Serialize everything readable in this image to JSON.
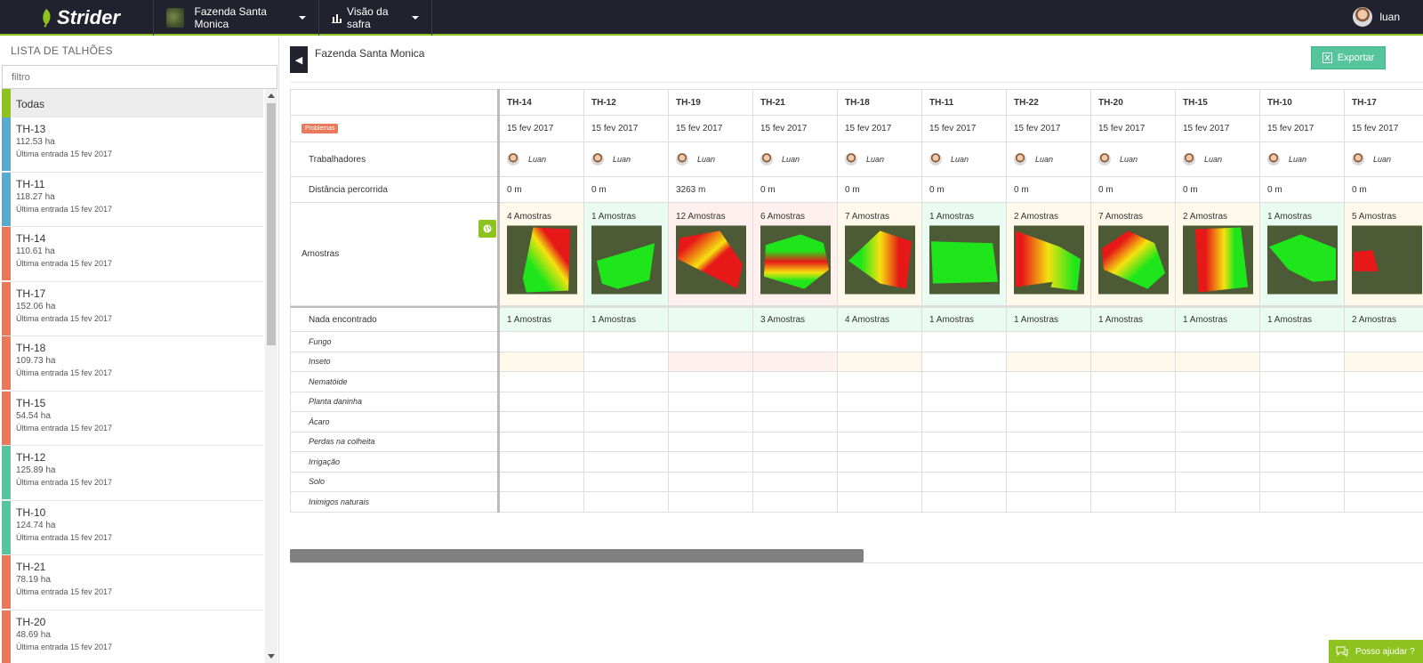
{
  "app": {
    "brand": "Strider",
    "farm": "Fazenda Santa Monica",
    "view": "Visão da safra",
    "user": "luan"
  },
  "sidebar": {
    "title": "LISTA DE TALHÕES",
    "filter_placeholder": "filtro",
    "all_label": "Todas",
    "items": [
      {
        "name": "TH-13",
        "area": "112.53 ha",
        "date": "Última entrada 15 fev 2017",
        "color": "#5aa9cf"
      },
      {
        "name": "TH-11",
        "area": "118.27 ha",
        "date": "Última entrada 15 fev 2017",
        "color": "#5aa9cf"
      },
      {
        "name": "TH-14",
        "area": "110.61 ha",
        "date": "Última entrada 15 fev 2017",
        "color": "#e8795a"
      },
      {
        "name": "TH-17",
        "area": "152.06 ha",
        "date": "Última entrada 15 fev 2017",
        "color": "#e8795a"
      },
      {
        "name": "TH-18",
        "area": "109.73 ha",
        "date": "Última entrada 15 fev 2017",
        "color": "#e8795a"
      },
      {
        "name": "TH-15",
        "area": "54.54 ha",
        "date": "Última entrada 15 fev 2017",
        "color": "#e8795a"
      },
      {
        "name": "TH-12",
        "area": "125.89 ha",
        "date": "Última entrada 15 fev 2017",
        "color": "#56c59e"
      },
      {
        "name": "TH-10",
        "area": "124.74 ha",
        "date": "Última entrada 15 fev 2017",
        "color": "#56c59e"
      },
      {
        "name": "TH-21",
        "area": "78.19 ha",
        "date": "Última entrada 15 fev 2017",
        "color": "#e8795a"
      },
      {
        "name": "TH-20",
        "area": "48.69 ha",
        "date": "Última entrada 15 fev 2017",
        "color": "#e8795a"
      }
    ]
  },
  "main": {
    "title": "Fazenda Santa Monica",
    "export_label": "Exportar",
    "row_labels": {
      "problems": "Problemas",
      "workers": "Trabalhadores",
      "distance": "Distância percorrida",
      "samples": "Amostras",
      "nothing": "Nada encontrado",
      "subs": [
        "Fungo",
        "Inseto",
        "Nematóide",
        "Planta daninha",
        "Ácaro",
        "Perdas na colheita",
        "Irrigação",
        "Solo",
        "Inimigos naturais"
      ]
    },
    "columns": [
      {
        "name": "TH-14",
        "date": "15 fev 2017",
        "worker": "Luan",
        "distance": "0 m",
        "samples": "4 Amostras",
        "nothing": "1 Amostras",
        "sample_bg": "#fff9ec",
        "inseto_bg": "#fff9ec",
        "map": "a"
      },
      {
        "name": "TH-12",
        "date": "15 fev 2017",
        "worker": "Luan",
        "distance": "0 m",
        "samples": "1 Amostras",
        "nothing": "1 Amostras",
        "sample_bg": "#eafbf1",
        "inseto_bg": "#ffffff",
        "map": "b"
      },
      {
        "name": "TH-19",
        "date": "15 fev 2017",
        "worker": "Luan",
        "distance": "3263 m",
        "samples": "12 Amostras",
        "nothing": "",
        "sample_bg": "#fdf0ee",
        "inseto_bg": "#fdf0ee",
        "map": "c"
      },
      {
        "name": "TH-21",
        "date": "15 fev 2017",
        "worker": "Luan",
        "distance": "0 m",
        "samples": "6 Amostras",
        "nothing": "3 Amostras",
        "sample_bg": "#fdf0ee",
        "inseto_bg": "#fdf0ee",
        "map": "d"
      },
      {
        "name": "TH-18",
        "date": "15 fev 2017",
        "worker": "Luan",
        "distance": "0 m",
        "samples": "7 Amostras",
        "nothing": "4 Amostras",
        "sample_bg": "#fff9ec",
        "inseto_bg": "#fff9ec",
        "map": "e"
      },
      {
        "name": "TH-11",
        "date": "15 fev 2017",
        "worker": "Luan",
        "distance": "0 m",
        "samples": "1 Amostras",
        "nothing": "1 Amostras",
        "sample_bg": "#eafbf1",
        "inseto_bg": "#ffffff",
        "map": "f"
      },
      {
        "name": "TH-22",
        "date": "15 fev 2017",
        "worker": "Luan",
        "distance": "0 m",
        "samples": "2 Amostras",
        "nothing": "1 Amostras",
        "sample_bg": "#fff9ec",
        "inseto_bg": "#fff9ec",
        "map": "g"
      },
      {
        "name": "TH-20",
        "date": "15 fev 2017",
        "worker": "Luan",
        "distance": "0 m",
        "samples": "7 Amostras",
        "nothing": "1 Amostras",
        "sample_bg": "#fff9ec",
        "inseto_bg": "#fff9ec",
        "map": "h"
      },
      {
        "name": "TH-15",
        "date": "15 fev 2017",
        "worker": "Luan",
        "distance": "0 m",
        "samples": "2 Amostras",
        "nothing": "1 Amostras",
        "sample_bg": "#fff9ec",
        "inseto_bg": "#fff9ec",
        "map": "i"
      },
      {
        "name": "TH-10",
        "date": "15 fev 2017",
        "worker": "Luan",
        "distance": "0 m",
        "samples": "1 Amostras",
        "nothing": "1 Amostras",
        "sample_bg": "#eafbf1",
        "inseto_bg": "#ffffff",
        "map": "j"
      },
      {
        "name": "TH-17",
        "date": "15 fev 2017",
        "worker": "Luan",
        "distance": "0 m",
        "samples": "5 Amostras",
        "nothing": "2 Amostras",
        "sample_bg": "#fff9ec",
        "inseto_bg": "#fff9ec",
        "map": "k"
      }
    ]
  },
  "help_label": "Posso ajudar ?"
}
